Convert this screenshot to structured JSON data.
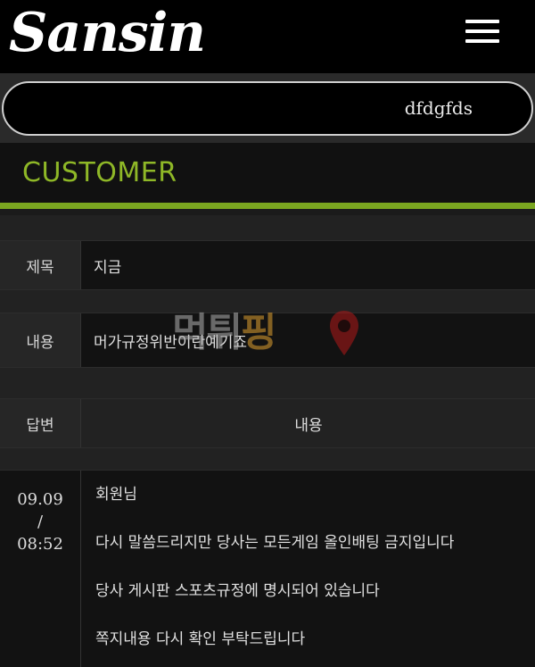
{
  "header": {
    "logo_text": "Sansin",
    "menu_icon": "hamburger-menu-icon"
  },
  "user": {
    "name": "dfdgfds"
  },
  "section": {
    "title": "CUSTOMER"
  },
  "post": {
    "subject_label": "제목",
    "subject_value": "지금",
    "content_label": "내용",
    "content_value": "머가규정위반이란예기죠"
  },
  "reply": {
    "header_label": "답변",
    "header_content_label": "내용",
    "date": "09.09",
    "separator": "/",
    "time": "08:52",
    "lines": [
      "회원님",
      "다시 말씀드리지만 당사는 모든게임 올인배팅 금지입니다",
      "당사 게시판 스포츠규정에 명시되어 있습니다",
      "쪽지내용 다시 확인 부탁드립니다"
    ]
  },
  "watermark": {
    "text_main": "먹튀",
    "text_highlight": "핑",
    "pin_icon": "map-pin-icon"
  },
  "colors": {
    "accent_green": "#8fb827",
    "header_bg": "#000000"
  }
}
